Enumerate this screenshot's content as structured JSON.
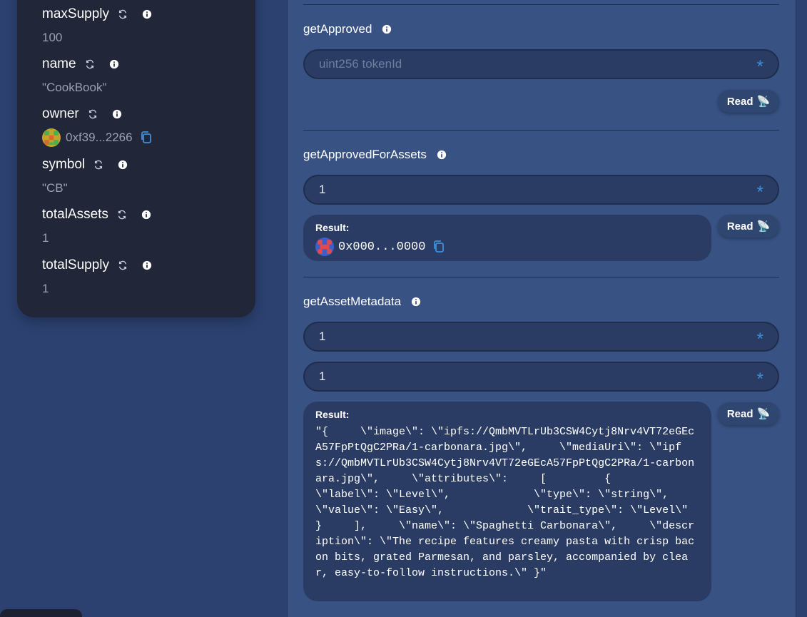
{
  "variables": [
    {
      "name": "maxSupply",
      "value": "100"
    },
    {
      "name": "name",
      "value": "\"CookBook\""
    },
    {
      "name": "owner",
      "value": "0xf39...2266"
    },
    {
      "name": "symbol",
      "value": "\"CB\""
    },
    {
      "name": "totalAssets",
      "value": "1"
    },
    {
      "name": "totalSupply",
      "value": "1"
    }
  ],
  "functions": {
    "getApproved": {
      "title": "getApproved",
      "input_placeholder": "uint256 tokenId",
      "read_label": "Read"
    },
    "getApprovedForAssets": {
      "title": "getApprovedForAssets",
      "input_value": "1",
      "read_label": "Read",
      "result_label": "Result:",
      "result_value": "0x000...0000"
    },
    "getAssetMetadata": {
      "title": "getAssetMetadata",
      "input1_value": "1",
      "input2_value": "1",
      "read_label": "Read",
      "result_label": "Result:",
      "result_value": "\"{     \\\"image\\\": \\\"ipfs://QmbMVTLrUb3CSW4Cytj8Nrv4VT72eGEcA57FpPtQgC2PRa/1-carbonara.jpg\\\",     \\\"mediaUri\\\": \\\"ipfs://QmbMVTLrUb3CSW4Cytj8Nrv4VT72eGEcA57FpPtQgC2PRa/1-carbonara.jpg\\\",     \\\"attributes\\\":     [         {             \\\"label\\\": \\\"Level\\\",             \\\"type\\\": \\\"string\\\",             \\\"value\\\": \\\"Easy\\\",             \\\"trait_type\\\": \\\"Level\\\"         }     ],     \\\"name\\\": \\\"Spaghetti Carbonara\\\",     \\\"description\\\": \\\"The recipe features creamy pasta with crisp bacon bits, grated Parmesan, and parsley, accompanied by clear, easy-to-follow instructions.\\\" }\""
    }
  },
  "icons": {
    "refresh": "refresh-icon",
    "info": "info-icon",
    "copy": "copy-icon",
    "satellite": "satellite-antenna-icon",
    "required": "asterisk-icon"
  },
  "colors": {
    "panel": "#385284",
    "card": "#212638",
    "accent": "#3f8fd6"
  }
}
